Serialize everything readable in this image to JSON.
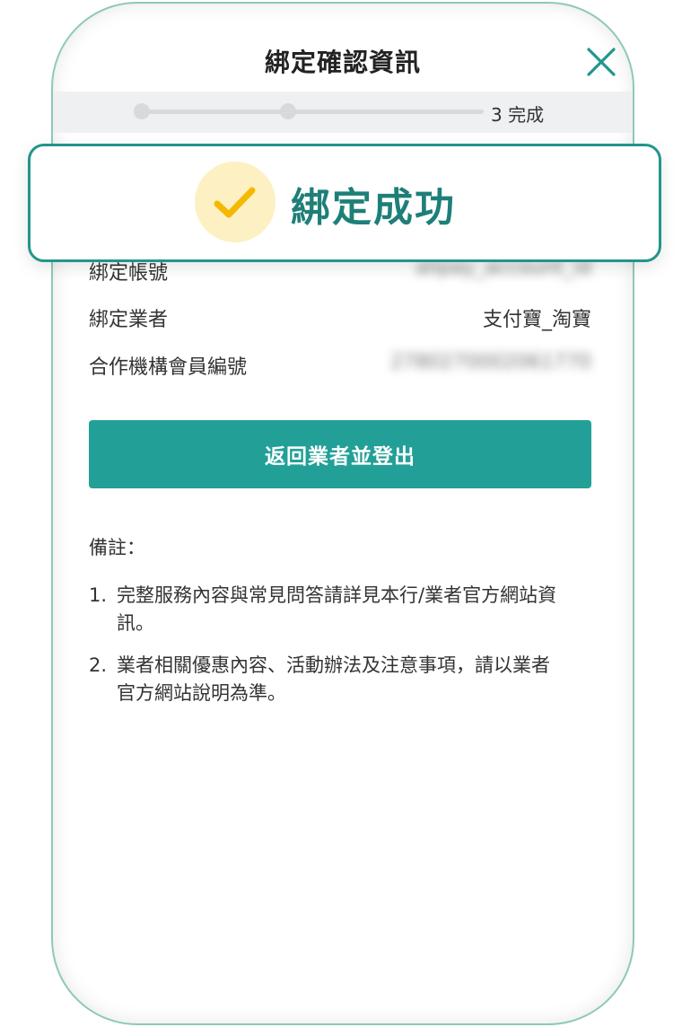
{
  "header": {
    "title": "綁定確認資訊",
    "close_icon": "close-icon"
  },
  "progress": {
    "label": "3 完成"
  },
  "details": {
    "rows": [
      {
        "label": "綁定帳號",
        "value": "alipay_account_id"
      },
      {
        "label": "綁定業者",
        "value": "支付寶_淘寶"
      },
      {
        "label": "合作機構會員編號",
        "value": "2780270002061770"
      }
    ]
  },
  "action": {
    "button_label": "返回業者並登出"
  },
  "notes": {
    "title": "備註：",
    "items": [
      {
        "num": "1.",
        "text": "完整服務內容與常見問答請詳見本行/業者官方網站資訊。"
      },
      {
        "num": "2.",
        "text": "業者相關優惠內容、活動辦法及注意事項，請以業者官方網站說明為準。"
      }
    ]
  },
  "toast": {
    "message": "綁定成功",
    "icon": "check-icon"
  },
  "colors": {
    "accent": "#22a097",
    "toast_border": "#22958c",
    "toast_text": "#1e7f78",
    "check": "#f5b800",
    "check_bg": "#fdf0c2"
  }
}
